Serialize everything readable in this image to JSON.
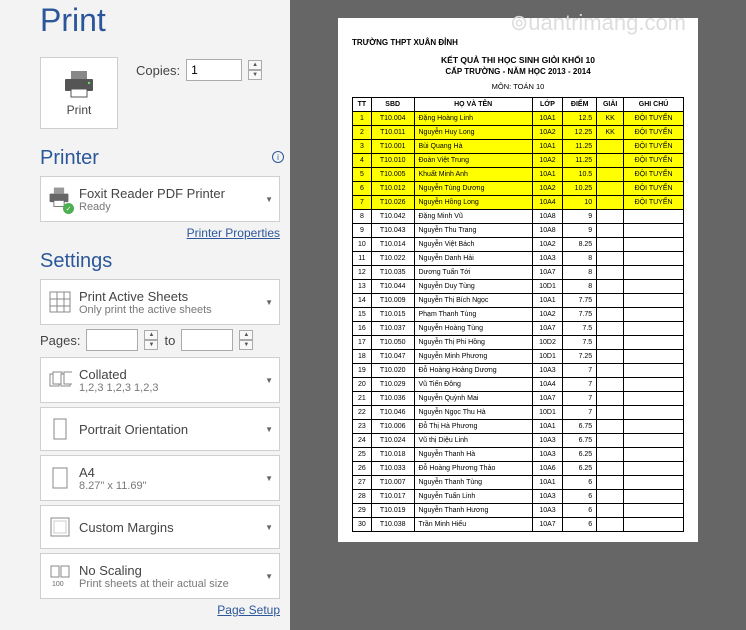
{
  "title": "Print",
  "copies": {
    "label": "Copies:",
    "value": "1"
  },
  "print_button": {
    "label": "Print"
  },
  "printer": {
    "section": "Printer",
    "name": "Foxit Reader PDF Printer",
    "status": "Ready",
    "properties_link": "Printer Properties"
  },
  "settings": {
    "section": "Settings",
    "sheets": {
      "primary": "Print Active Sheets",
      "secondary": "Only print the active sheets"
    },
    "pages": {
      "label": "Pages:",
      "from": "",
      "to_label": "to",
      "to": ""
    },
    "collated": {
      "primary": "Collated",
      "secondary": "1,2,3   1,2,3   1,2,3"
    },
    "orientation": {
      "primary": "Portrait Orientation"
    },
    "paper": {
      "primary": "A4",
      "secondary": "8.27\" x 11.69\""
    },
    "margins": {
      "primary": "Custom Margins"
    },
    "scaling": {
      "primary": "No Scaling",
      "secondary": "Print sheets at their actual size"
    },
    "page_setup_link": "Page Setup"
  },
  "preview": {
    "school": "TRƯỜNG THPT XUÂN ĐỈNH",
    "heading": "KẾT QUẢ THI HỌC SINH GIỎI KHỐI 10",
    "subheading": "CẤP TRƯỜNG - NĂM HỌC 2013 - 2014",
    "subject": "MÔN: TOÁN 10",
    "columns": [
      "TT",
      "SBD",
      "HỌ VÀ TÊN",
      "LỚP",
      "ĐIỂM",
      "GIẢI",
      "GHI CHÚ"
    ],
    "rows": [
      {
        "tt": "1",
        "sbd": "T10.004",
        "name": "Đặng Hoàng Linh",
        "lop": "10A1",
        "diem": "12.5",
        "giai": "KK",
        "ghichu": "ĐỘI TUYỂN",
        "hl": true
      },
      {
        "tt": "2",
        "sbd": "T10.011",
        "name": "Nguyễn Huy Long",
        "lop": "10A2",
        "diem": "12.25",
        "giai": "KK",
        "ghichu": "ĐỘI TUYỂN",
        "hl": true
      },
      {
        "tt": "3",
        "sbd": "T10.001",
        "name": "Bùi Quang Hà",
        "lop": "10A1",
        "diem": "11.25",
        "giai": "",
        "ghichu": "ĐỘI TUYỂN",
        "hl": true
      },
      {
        "tt": "4",
        "sbd": "T10.010",
        "name": "Đoàn Việt Trung",
        "lop": "10A2",
        "diem": "11.25",
        "giai": "",
        "ghichu": "ĐỘI TUYỂN",
        "hl": true
      },
      {
        "tt": "5",
        "sbd": "T10.005",
        "name": "Khuất Minh Anh",
        "lop": "10A1",
        "diem": "10.5",
        "giai": "",
        "ghichu": "ĐỘI TUYỂN",
        "hl": true
      },
      {
        "tt": "6",
        "sbd": "T10.012",
        "name": "Nguyễn Tùng Dương",
        "lop": "10A2",
        "diem": "10.25",
        "giai": "",
        "ghichu": "ĐỘI TUYỂN",
        "hl": true
      },
      {
        "tt": "7",
        "sbd": "T10.026",
        "name": "Nguyễn Hồng Long",
        "lop": "10A4",
        "diem": "10",
        "giai": "",
        "ghichu": "ĐỘI TUYỂN",
        "hl": true
      },
      {
        "tt": "8",
        "sbd": "T10.042",
        "name": "Đặng Minh Vũ",
        "lop": "10A8",
        "diem": "9",
        "giai": "",
        "ghichu": ""
      },
      {
        "tt": "9",
        "sbd": "T10.043",
        "name": "Nguyễn Thu Trang",
        "lop": "10A8",
        "diem": "9",
        "giai": "",
        "ghichu": ""
      },
      {
        "tt": "10",
        "sbd": "T10.014",
        "name": "Nguyễn Việt Bách",
        "lop": "10A2",
        "diem": "8.25",
        "giai": "",
        "ghichu": ""
      },
      {
        "tt": "11",
        "sbd": "T10.022",
        "name": "Nguyễn Danh Hải",
        "lop": "10A3",
        "diem": "8",
        "giai": "",
        "ghichu": ""
      },
      {
        "tt": "12",
        "sbd": "T10.035",
        "name": "Dương Tuấn Tới",
        "lop": "10A7",
        "diem": "8",
        "giai": "",
        "ghichu": ""
      },
      {
        "tt": "13",
        "sbd": "T10.044",
        "name": "Nguyễn Duy Tùng",
        "lop": "10D1",
        "diem": "8",
        "giai": "",
        "ghichu": ""
      },
      {
        "tt": "14",
        "sbd": "T10.009",
        "name": "Nguyễn Thị Bích Ngọc",
        "lop": "10A1",
        "diem": "7.75",
        "giai": "",
        "ghichu": ""
      },
      {
        "tt": "15",
        "sbd": "T10.015",
        "name": "Phạm Thanh Tùng",
        "lop": "10A2",
        "diem": "7.75",
        "giai": "",
        "ghichu": ""
      },
      {
        "tt": "16",
        "sbd": "T10.037",
        "name": "Nguyễn Hoàng Tùng",
        "lop": "10A7",
        "diem": "7.5",
        "giai": "",
        "ghichu": ""
      },
      {
        "tt": "17",
        "sbd": "T10.050",
        "name": "Nguyễn Thị Phi Hồng",
        "lop": "10D2",
        "diem": "7.5",
        "giai": "",
        "ghichu": ""
      },
      {
        "tt": "18",
        "sbd": "T10.047",
        "name": "Nguyễn Minh Phương",
        "lop": "10D1",
        "diem": "7.25",
        "giai": "",
        "ghichu": ""
      },
      {
        "tt": "19",
        "sbd": "T10.020",
        "name": "Đỗ Hoàng Hoàng Dương",
        "lop": "10A3",
        "diem": "7",
        "giai": "",
        "ghichu": ""
      },
      {
        "tt": "20",
        "sbd": "T10.029",
        "name": "Vũ Tiến Đông",
        "lop": "10A4",
        "diem": "7",
        "giai": "",
        "ghichu": ""
      },
      {
        "tt": "21",
        "sbd": "T10.036",
        "name": "Nguyễn Quỳnh Mai",
        "lop": "10A7",
        "diem": "7",
        "giai": "",
        "ghichu": ""
      },
      {
        "tt": "22",
        "sbd": "T10.046",
        "name": "Nguyễn Ngọc Thu Hà",
        "lop": "10D1",
        "diem": "7",
        "giai": "",
        "ghichu": ""
      },
      {
        "tt": "23",
        "sbd": "T10.006",
        "name": "Đỗ Thị Hà Phương",
        "lop": "10A1",
        "diem": "6.75",
        "giai": "",
        "ghichu": ""
      },
      {
        "tt": "24",
        "sbd": "T10.024",
        "name": "Vũ thị Diệu Linh",
        "lop": "10A3",
        "diem": "6.75",
        "giai": "",
        "ghichu": ""
      },
      {
        "tt": "25",
        "sbd": "T10.018",
        "name": "Nguyễn Thanh Hà",
        "lop": "10A3",
        "diem": "6.25",
        "giai": "",
        "ghichu": ""
      },
      {
        "tt": "26",
        "sbd": "T10.033",
        "name": "Đỗ Hoàng Phương Thảo",
        "lop": "10A6",
        "diem": "6.25",
        "giai": "",
        "ghichu": ""
      },
      {
        "tt": "27",
        "sbd": "T10.007",
        "name": "Nguyễn Thanh Tùng",
        "lop": "10A1",
        "diem": "6",
        "giai": "",
        "ghichu": ""
      },
      {
        "tt": "28",
        "sbd": "T10.017",
        "name": "Nguyễn Tuấn Linh",
        "lop": "10A3",
        "diem": "6",
        "giai": "",
        "ghichu": ""
      },
      {
        "tt": "29",
        "sbd": "T10.019",
        "name": "Nguyễn Thanh Hương",
        "lop": "10A3",
        "diem": "6",
        "giai": "",
        "ghichu": ""
      },
      {
        "tt": "30",
        "sbd": "T10.038",
        "name": "Trần Minh Hiếu",
        "lop": "10A7",
        "diem": "6",
        "giai": "",
        "ghichu": ""
      }
    ]
  }
}
